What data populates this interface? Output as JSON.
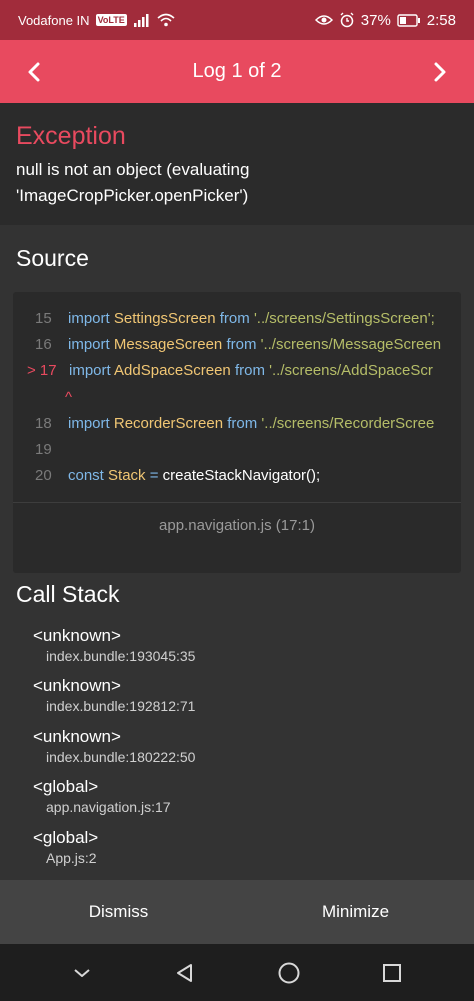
{
  "status_bar": {
    "carrier": "Vodafone IN",
    "volte": "VoLTE",
    "battery": "37%",
    "time": "2:58"
  },
  "header": {
    "title": "Log 1 of 2",
    "prev_icon": "chevron-left-icon",
    "next_icon": "chevron-right-icon"
  },
  "exception": {
    "title": "Exception",
    "message_line1": "null is not an object (evaluating",
    "message_line2": "'ImageCropPicker.openPicker')"
  },
  "source": {
    "title": "Source",
    "lines": [
      {
        "num": "15",
        "kw": "import",
        "id": "SettingsScreen",
        "from": "from",
        "str": "'../screens/SettingsScreen';"
      },
      {
        "num": "16",
        "kw": "import",
        "id": "MessageScreen",
        "from": "from",
        "str": "'../screens/MessageScreen"
      },
      {
        "num": "> 17",
        "kw": "import",
        "id": "AddSpaceScreen",
        "from": "from",
        "str": "'../screens/AddSpaceScr"
      },
      {
        "num": "18",
        "kw": "import",
        "id": "RecorderScreen",
        "from": "from",
        "str": "'../screens/RecorderScree"
      },
      {
        "num": "19"
      },
      {
        "num": "20",
        "kw": "const",
        "id": "Stack",
        "op": "=",
        "rest": "createStackNavigator();"
      }
    ],
    "caret": "^",
    "footer": "app.navigation.js (17:1)"
  },
  "call_stack": {
    "title": "Call Stack",
    "frames": [
      {
        "fn": "<unknown>",
        "loc": "index.bundle:193045:35"
      },
      {
        "fn": "<unknown>",
        "loc": "index.bundle:192812:71"
      },
      {
        "fn": "<unknown>",
        "loc": "index.bundle:180222:50"
      },
      {
        "fn": "<global>",
        "loc": "app.navigation.js:17"
      },
      {
        "fn": "<global>",
        "loc": "App.js:2"
      }
    ]
  },
  "actions": {
    "dismiss": "Dismiss",
    "minimize": "Minimize"
  },
  "colors": {
    "accent": "#e84a5f",
    "status_bar": "#a12c3b",
    "background": "#333333"
  }
}
